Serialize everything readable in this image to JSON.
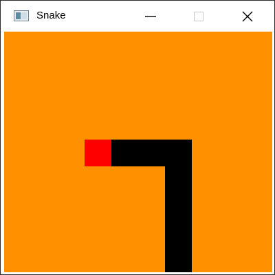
{
  "window": {
    "title": "Snake",
    "icon": "window-app-icon",
    "controls": [
      {
        "name": "minimize-button",
        "icon": "minimize-icon"
      },
      {
        "name": "maximize-button",
        "icon": "maximize-icon",
        "enabled": false
      },
      {
        "name": "close-button",
        "icon": "close-icon"
      }
    ]
  },
  "game": {
    "background_color": "#ff9100",
    "snake_color": "#000000",
    "head_color": "#ff0000",
    "grid_cell_units": "cells",
    "head": {
      "col": 3,
      "row": 4
    },
    "snake_body": [
      {
        "col": 4,
        "row": 4
      },
      {
        "col": 5,
        "row": 4
      },
      {
        "col": 6,
        "row": 4
      },
      {
        "col": 6,
        "row": 5
      },
      {
        "col": 6,
        "row": 6
      },
      {
        "col": 6,
        "row": 7
      },
      {
        "col": 6,
        "row": 8
      }
    ]
  }
}
